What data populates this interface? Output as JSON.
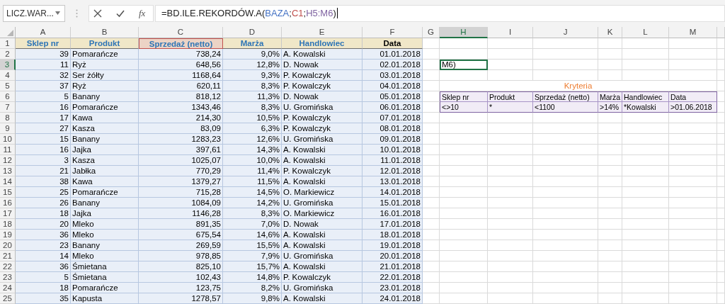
{
  "name_box": {
    "value": "LICZ.WAR..."
  },
  "formula_bar": {
    "function_label": "fx",
    "parts": [
      {
        "text": "=BD.ILE.REKORDÓW.A("
      },
      {
        "text": "BAZA",
        "color": "#4472c4"
      },
      {
        "text": ";"
      },
      {
        "text": "C1",
        "color": "#c0504d"
      },
      {
        "text": ";"
      },
      {
        "text": "H5:M6",
        "color": "#8064a2"
      },
      {
        "text": ")"
      }
    ]
  },
  "columns": [
    {
      "label": "A",
      "selected": false
    },
    {
      "label": "B",
      "selected": false
    },
    {
      "label": "C",
      "selected": false
    },
    {
      "label": "D",
      "selected": false
    },
    {
      "label": "E",
      "selected": false
    },
    {
      "label": "F",
      "selected": false
    },
    {
      "label": "G",
      "selected": false
    },
    {
      "label": "H",
      "selected": true
    },
    {
      "label": "I",
      "selected": false
    },
    {
      "label": "J",
      "selected": false
    },
    {
      "label": "K",
      "selected": false
    },
    {
      "label": "L",
      "selected": false
    },
    {
      "label": "M",
      "selected": false
    }
  ],
  "rows": [
    {
      "label": "1",
      "selected": false
    },
    {
      "label": "2",
      "selected": false
    },
    {
      "label": "3",
      "selected": true
    },
    {
      "label": "4",
      "selected": false
    },
    {
      "label": "5",
      "selected": false
    },
    {
      "label": "6",
      "selected": false
    },
    {
      "label": "7",
      "selected": false
    },
    {
      "label": "8",
      "selected": false
    },
    {
      "label": "9",
      "selected": false
    },
    {
      "label": "10",
      "selected": false
    },
    {
      "label": "11",
      "selected": false
    },
    {
      "label": "12",
      "selected": false
    },
    {
      "label": "13",
      "selected": false
    },
    {
      "label": "14",
      "selected": false
    },
    {
      "label": "15",
      "selected": false
    },
    {
      "label": "16",
      "selected": false
    },
    {
      "label": "17",
      "selected": false
    },
    {
      "label": "18",
      "selected": false
    },
    {
      "label": "19",
      "selected": false
    },
    {
      "label": "20",
      "selected": false
    },
    {
      "label": "21",
      "selected": false
    },
    {
      "label": "22",
      "selected": false
    },
    {
      "label": "23",
      "selected": false
    },
    {
      "label": "24",
      "selected": false
    },
    {
      "label": "25",
      "selected": false
    }
  ],
  "table": {
    "headers": [
      {
        "text": "Sklep nr",
        "color": "#2e75b6",
        "referenced": false
      },
      {
        "text": "Produkt",
        "color": "#2e75b6",
        "referenced": false
      },
      {
        "text": "Sprzedaż (netto)",
        "color": "#2e75b6",
        "referenced": true
      },
      {
        "text": "Marża",
        "color": "#2e75b6",
        "referenced": false
      },
      {
        "text": "Handlowiec",
        "color": "#2e75b6",
        "referenced": false
      },
      {
        "text": "Data",
        "color": "#000000",
        "referenced": false
      }
    ],
    "rows": [
      [
        "39",
        "Pomarańcze",
        "738,24",
        "9,0%",
        "A. Kowalski",
        "01.01.2018"
      ],
      [
        "11",
        "Ryż",
        "648,56",
        "12,8%",
        "D. Nowak",
        "02.01.2018"
      ],
      [
        "32",
        "Ser żółty",
        "1168,64",
        "9,3%",
        "P. Kowalczyk",
        "03.01.2018"
      ],
      [
        "37",
        "Ryż",
        "620,11",
        "8,3%",
        "P. Kowalczyk",
        "04.01.2018"
      ],
      [
        "5",
        "Banany",
        "818,12",
        "11,3%",
        "D. Nowak",
        "05.01.2018"
      ],
      [
        "16",
        "Pomarańcze",
        "1343,46",
        "8,3%",
        "U. Gromińska",
        "06.01.2018"
      ],
      [
        "17",
        "Kawa",
        "214,30",
        "10,5%",
        "P. Kowalczyk",
        "07.01.2018"
      ],
      [
        "27",
        "Kasza",
        "83,09",
        "6,3%",
        "P. Kowalczyk",
        "08.01.2018"
      ],
      [
        "15",
        "Banany",
        "1283,23",
        "12,6%",
        "U. Gromińska",
        "09.01.2018"
      ],
      [
        "16",
        "Jajka",
        "397,61",
        "14,3%",
        "A. Kowalski",
        "10.01.2018"
      ],
      [
        "3",
        "Kasza",
        "1025,07",
        "10,0%",
        "A. Kowalski",
        "11.01.2018"
      ],
      [
        "21",
        "Jabłka",
        "770,29",
        "11,4%",
        "P. Kowalczyk",
        "12.01.2018"
      ],
      [
        "38",
        "Kawa",
        "1379,27",
        "11,5%",
        "A. Kowalski",
        "13.01.2018"
      ],
      [
        "25",
        "Pomarańcze",
        "715,28",
        "14,5%",
        "O. Markiewicz",
        "14.01.2018"
      ],
      [
        "26",
        "Banany",
        "1084,09",
        "14,2%",
        "U. Gromińska",
        "15.01.2018"
      ],
      [
        "18",
        "Jajka",
        "1146,28",
        "8,3%",
        "O. Markiewicz",
        "16.01.2018"
      ],
      [
        "20",
        "Mleko",
        "891,35",
        "7,0%",
        "D. Nowak",
        "17.01.2018"
      ],
      [
        "36",
        "Mleko",
        "675,54",
        "14,6%",
        "A. Kowalski",
        "18.01.2018"
      ],
      [
        "23",
        "Banany",
        "269,59",
        "15,5%",
        "A. Kowalski",
        "19.01.2018"
      ],
      [
        "14",
        "Mleko",
        "978,85",
        "7,9%",
        "U. Gromińska",
        "20.01.2018"
      ],
      [
        "36",
        "Śmietana",
        "825,10",
        "15,7%",
        "A. Kowalski",
        "21.01.2018"
      ],
      [
        "5",
        "Śmietana",
        "102,43",
        "14,8%",
        "P. Kowalczyk",
        "22.01.2018"
      ],
      [
        "18",
        "Pomarańcze",
        "123,75",
        "8,2%",
        "U. Gromińska",
        "23.01.2018"
      ],
      [
        "35",
        "Kapusta",
        "1278,57",
        "9,8%",
        "A. Kowalski",
        "24.01.2018"
      ]
    ]
  },
  "active_cell": {
    "value": "M6)"
  },
  "criteria": {
    "title": "Kryteria",
    "headers": [
      "Sklep nr",
      "Produkt",
      "Sprzedaż (netto)",
      "Marża",
      "Handlowiec",
      "Data"
    ],
    "values": [
      "<>10",
      "*",
      "<1100",
      ">14%",
      "*Kowalski",
      ">01.06.2018"
    ]
  }
}
